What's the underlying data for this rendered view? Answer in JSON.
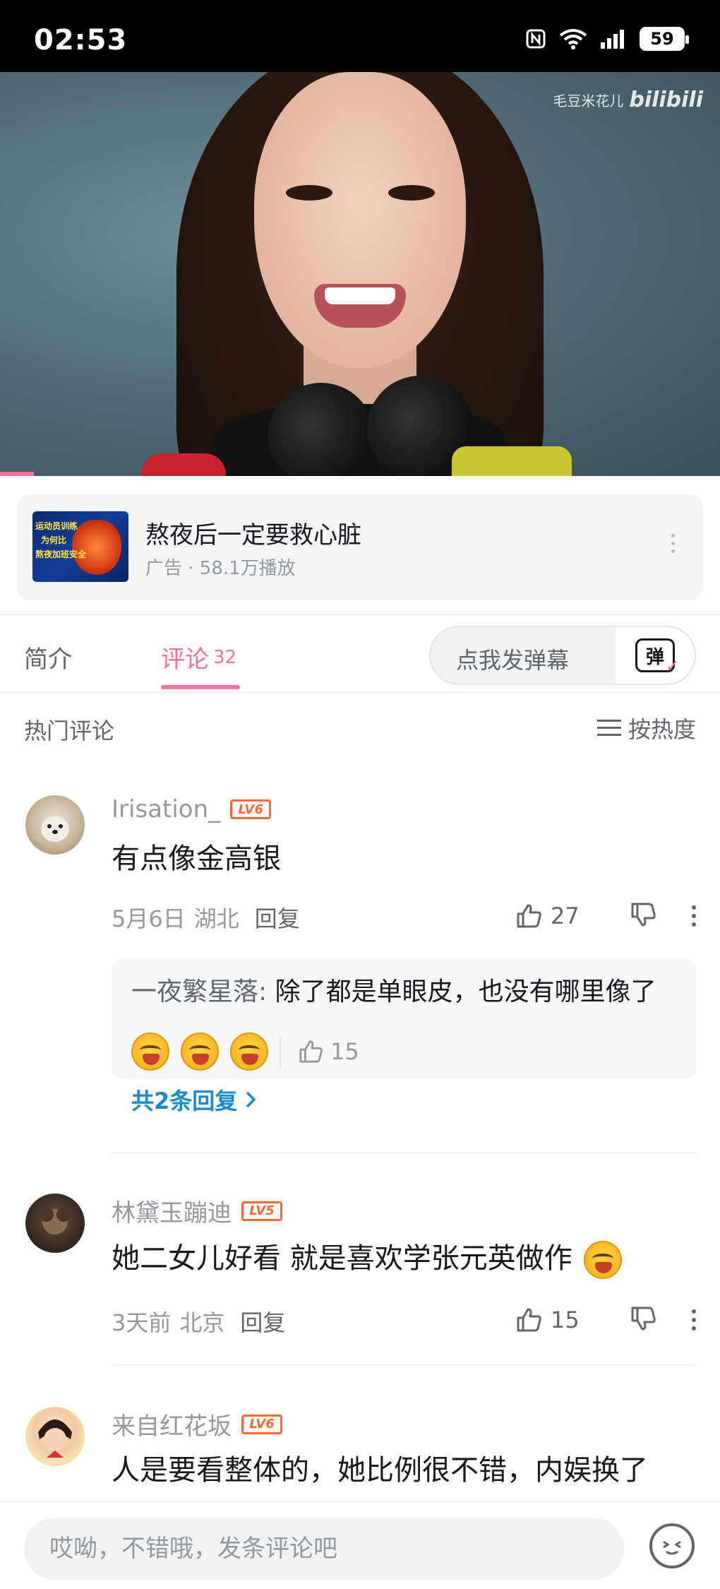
{
  "status_bar": {
    "time": "02:53",
    "battery": "59"
  },
  "video": {
    "watermark_user": "毛豆米花儿",
    "watermark_logo": "bilibili"
  },
  "ad": {
    "thumb_lines": [
      "运动员训练",
      "为何比",
      "熬夜加班安全"
    ],
    "title": "熬夜后一定要救心脏",
    "meta": "广告 · 58.1万播放"
  },
  "tabs": [
    {
      "label": "简介"
    },
    {
      "label": "评论",
      "count": "32"
    }
  ],
  "danmaku": {
    "placeholder": "点我发弹幕",
    "button": "弹"
  },
  "section": {
    "label": "热门评论",
    "sort": "按热度"
  },
  "comments": [
    {
      "user": "Irisation_",
      "level": "LV6",
      "text": "有点像金高银",
      "date": "5月6日",
      "location": "湖北",
      "reply_label": "回复",
      "likes": "27",
      "reply": {
        "name": "一夜繁星落:",
        "text": " 除了都是单眼皮，也没有哪里像了",
        "likes": "15",
        "more": "共2条回复"
      }
    },
    {
      "user": "林黛玉蹦迪",
      "level": "LV5",
      "text": "她二女儿好看  就是喜欢学张元英做作",
      "date": "3天前",
      "location": "北京",
      "reply_label": "回复",
      "likes": "15"
    },
    {
      "user": "来自红花坂",
      "level": "LV6",
      "text": "人是要看整体的，她比例很不错，内娱换了"
    }
  ],
  "bottom": {
    "placeholder": "哎呦，不错哦，发条评论吧"
  },
  "colors": {
    "accent": "#fb7299",
    "level_orange": "#ff6933",
    "link_blue": "#178bcf"
  }
}
